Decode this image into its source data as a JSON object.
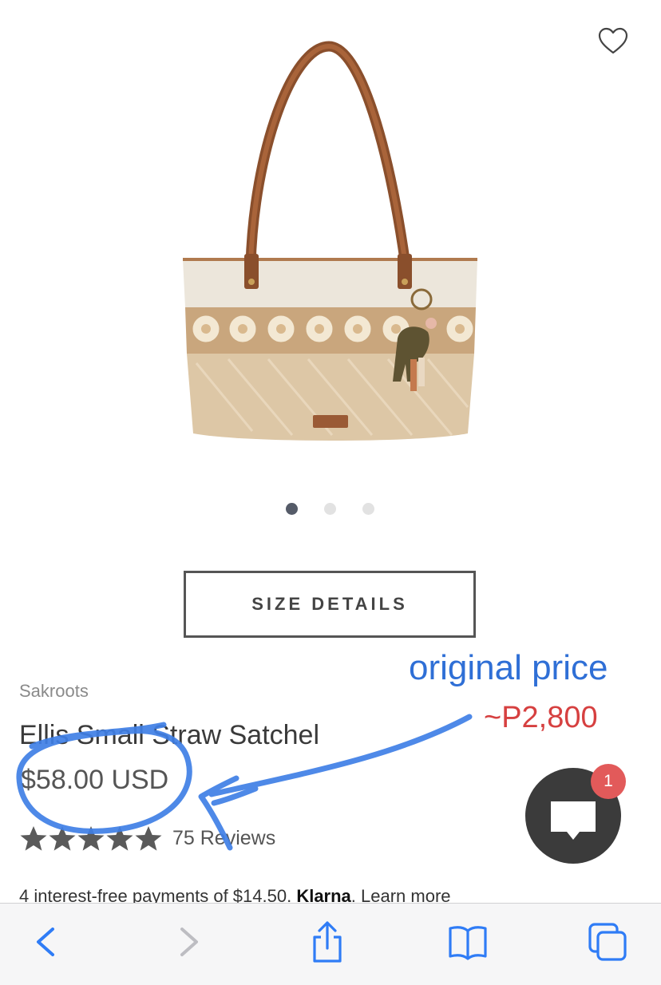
{
  "product": {
    "brand": "Sakroots",
    "title": "Ellis Small Straw Satchel",
    "price": "$58.00 USD",
    "rating_stars": 5,
    "reviews": "75 Reviews",
    "size_button": "SIZE DETAILS",
    "carousel_dots": 3,
    "carousel_active": 0
  },
  "klarna": {
    "text_before": "4 interest-free payments of $14.50. ",
    "brand": "Klarna",
    "learn_more": ". Learn more"
  },
  "annotations": {
    "original_price": "original price",
    "converted_price": "~P2,800"
  },
  "chat": {
    "badge_count": "1"
  },
  "colors": {
    "annotation_blue": "#2f6fd6",
    "annotation_red": "#d64040",
    "safari_blue": "#2f7cf6",
    "chat_bg": "#3b3b3b",
    "badge": "#e25a5a"
  },
  "toolbar": {
    "icons": [
      "back-icon",
      "forward-icon",
      "share-icon",
      "bookmarks-icon",
      "tabs-icon"
    ]
  }
}
